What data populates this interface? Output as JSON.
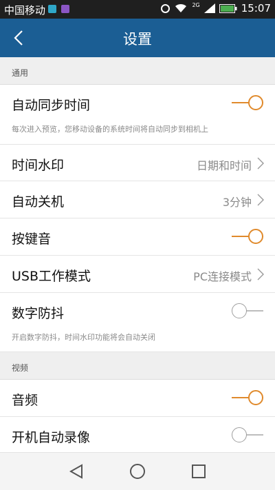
{
  "status_bar": {
    "carrier": "中国移动",
    "network_label": "2G",
    "time": "15:07"
  },
  "header": {
    "title": "设置"
  },
  "sections": {
    "general": {
      "title": "通用"
    },
    "video": {
      "title": "视频"
    }
  },
  "settings": {
    "auto_sync_time": {
      "label": "自动同步时间",
      "description": "每次进入预览，您移动设备的系统时间将自动同步到相机上",
      "enabled": true
    },
    "time_watermark": {
      "label": "时间水印",
      "value": "日期和时间"
    },
    "auto_shutdown": {
      "label": "自动关机",
      "value": "3分钟"
    },
    "key_sound": {
      "label": "按键音",
      "enabled": true
    },
    "usb_mode": {
      "label": "USB工作模式",
      "value": "PC连接模式"
    },
    "digital_stabilization": {
      "label": "数字防抖",
      "description": "开启数字防抖，时间水印功能将会自动关闭",
      "enabled": false
    },
    "audio": {
      "label": "音频",
      "enabled": true
    },
    "auto_record_on_boot": {
      "label": "开机自动录像",
      "enabled": false
    }
  },
  "colors": {
    "title_bar": "#1b5e94",
    "toggle_on": "#e08a2c",
    "toggle_off": "#bdbdbd"
  },
  "icons": {
    "back": "chevron-left-icon",
    "row_arrow": "chevron-right-icon",
    "nav_back": "triangle-back-icon",
    "nav_home": "circle-home-icon",
    "nav_recents": "square-recents-icon"
  }
}
